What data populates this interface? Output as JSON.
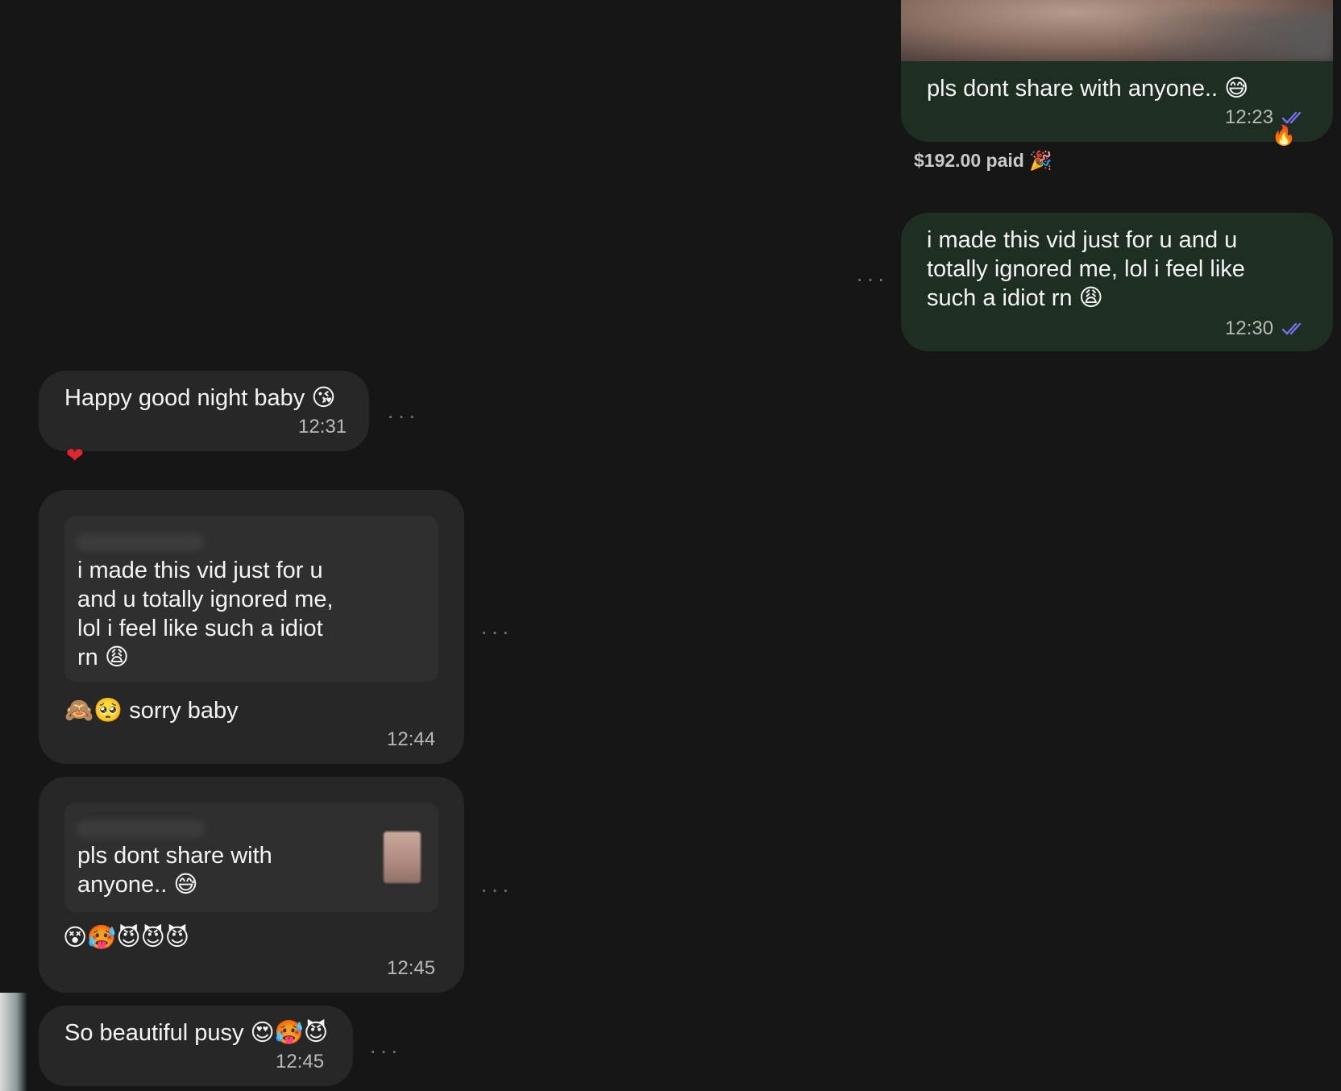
{
  "colors": {
    "background": "#161616",
    "outgoing_bubble": "#1f2e22",
    "incoming_bubble": "#272727",
    "read_ticks": "#7a6ff0"
  },
  "messages": [
    {
      "direction": "outgoing",
      "type": "media",
      "text": "pls dont share with anyone.. 😅",
      "time": "12:23",
      "status_icon": "double-check-icon",
      "reaction": "🔥",
      "footer": "$192.00 paid",
      "footer_icon": "🎉"
    },
    {
      "direction": "outgoing",
      "text": "i made this vid just for u and u\ntotally ignored me, lol i feel like\nsuch a idiot rn 😩",
      "time": "12:30",
      "status_icon": "double-check-icon"
    },
    {
      "direction": "incoming",
      "text": "Happy good night baby 😘",
      "time": "12:31",
      "reaction": "❤"
    },
    {
      "direction": "incoming",
      "quote": "i made this vid just for u\nand u totally ignored me,\nlol i feel like such a idiot\nrn 😩",
      "text": "🙈🥺 sorry baby",
      "time": "12:44"
    },
    {
      "direction": "incoming",
      "quote": "pls dont share with\nanyone.. 😅",
      "text": "😵🥵😈😈😈",
      "time": "12:45"
    },
    {
      "direction": "incoming",
      "text": "So beautiful pusy 😍🥵😈",
      "time": "12:45"
    }
  ],
  "more_label": "···"
}
